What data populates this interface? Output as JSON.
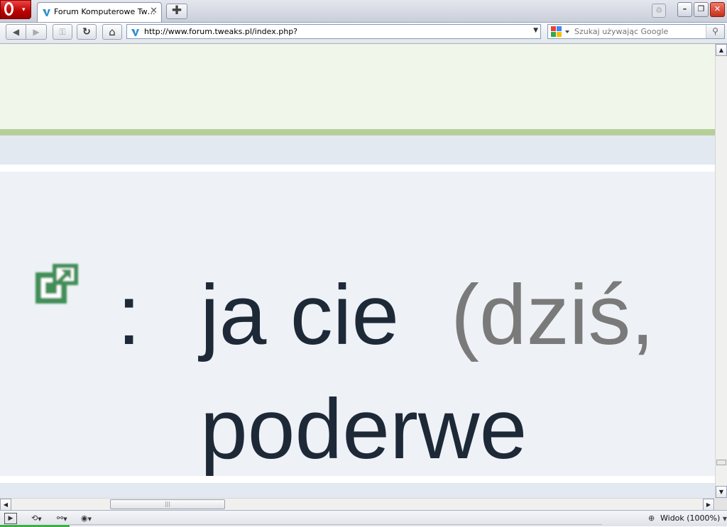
{
  "tab": {
    "title": "Forum Komputerowe Tw…",
    "close_glyph": "✕"
  },
  "newtab_glyph": "✚",
  "window": {
    "trash_glyph": "♲",
    "minimize_glyph": "–",
    "restore_glyph": "❐",
    "close_glyph": "✕"
  },
  "nav": {
    "back_glyph": "◀",
    "forward_glyph": "▶",
    "key_glyph": "⚿",
    "reload_glyph": "↻",
    "home_glyph": "⌂"
  },
  "address": {
    "url": "http://www.forum.tweaks.pl/index.php?",
    "dropdown_glyph": "▼"
  },
  "search": {
    "placeholder": "Szukaj używając Google",
    "go_glyph": "⚲",
    "engine": "google-icon"
  },
  "post": {
    "colon": ":",
    "text_line1": "ja cie",
    "date_fragment": "(dziś,",
    "text_line2": "poderwe",
    "icon": "new-window-icon"
  },
  "scrollbar": {
    "up_glyph": "▲",
    "down_glyph": "▼",
    "left_glyph": "◀",
    "right_glyph": "▶",
    "grip_glyph": "|||"
  },
  "status": {
    "zoom_label": "Widok (1000%)",
    "dropdown_glyph": "▼"
  },
  "colors": {
    "header_bg": "#f0f6ea",
    "stripe": "#b6cf98",
    "band": "#e3e9f1",
    "post_bg": "#eef2f7",
    "text": "#1e2938",
    "date_text": "#7a7a7a",
    "icon_green": "#3f8f57"
  }
}
